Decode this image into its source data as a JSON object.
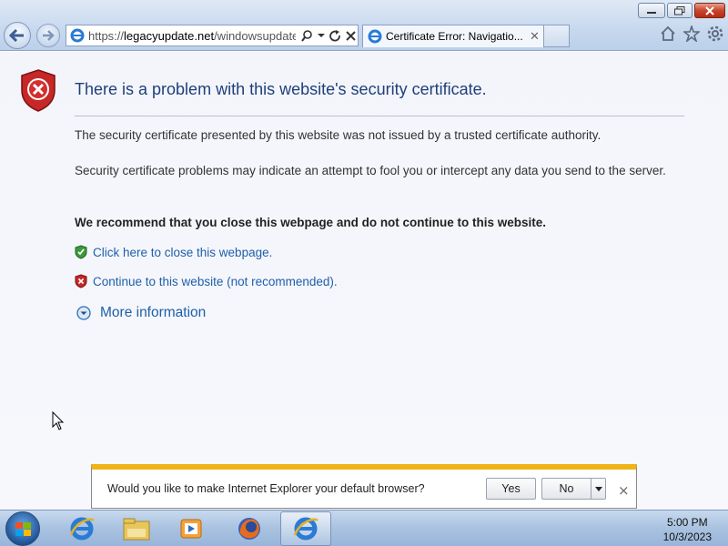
{
  "browser": {
    "address": {
      "url_scheme": "https://",
      "url_host": "legacyupdate.net",
      "url_path": "/windowsupdate/v"
    },
    "tab": {
      "title": "Certificate Error: Navigatio..."
    },
    "window_buttons": [
      "minimize-icon",
      "restore-icon",
      "close-icon"
    ],
    "toolbar_icons": [
      "home-icon",
      "favorites-star-icon",
      "tools-gear-icon"
    ]
  },
  "page": {
    "title": "There is a problem with this website's security certificate.",
    "paragraph1": "The security certificate presented by this website was not issued by a trusted certificate authority.",
    "paragraph2": "Security certificate problems may indicate an attempt to fool you or intercept any data you send to the server.",
    "recommendation": "We recommend that you close this webpage and do not continue to this website.",
    "close_link": "Click here to close this webpage.",
    "continue_link": "Continue to this website (not recommended).",
    "more_info": "More information"
  },
  "notification": {
    "message": "Would you like to make Internet Explorer your default browser?",
    "yes_label": "Yes",
    "no_label": "No",
    "close_label": "×"
  },
  "taskbar": {
    "items": [
      "internet-explorer-icon",
      "file-explorer-icon",
      "media-player-icon",
      "firefox-icon",
      "internet-explorer-active-icon"
    ],
    "time": "5:00 PM",
    "date": "10/3/2023"
  },
  "colors": {
    "accent_link": "#1f5fa8",
    "title_blue": "#1f3f7a",
    "notification_bar": "#f0b316",
    "error_red": "#c62828"
  }
}
